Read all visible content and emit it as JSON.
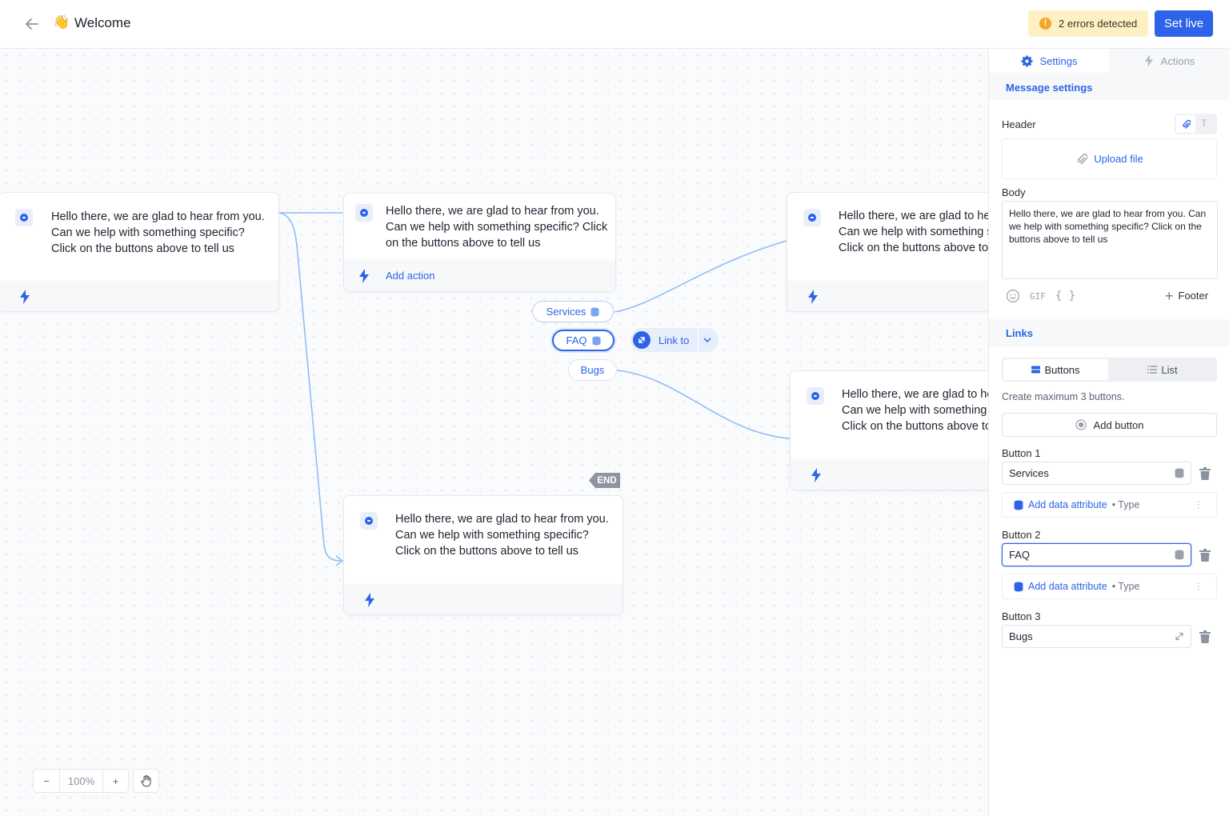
{
  "header": {
    "back_label": "←",
    "title_emoji": "👋",
    "title": "Welcome",
    "errors_label": "2 errors detected",
    "errors_icon": "!",
    "set_live_label": "Set live"
  },
  "canvas": {
    "nodes": [
      {
        "text": "Hello there, we are glad to hear from you. Can we help with something specific? Click on the buttons above to tell us"
      },
      {
        "text": "Hello there, we are glad to hear from you. Can we help with something specific? Click on the buttons above to tell us",
        "add_action": "Add action"
      },
      {
        "text": "Hello there, we are glad to hear from you. Can we help with something specific? Click on the buttons above to tell us"
      },
      {
        "text": "Hello there, we are glad to hear from you. Can we help with something specific? Click on the buttons above to tell us"
      },
      {
        "text": "Hello there, we are glad to hear from you. Can we help with something specific? Click on the buttons above to tell us"
      }
    ],
    "choice_pills": [
      "Services",
      "FAQ",
      "Bugs"
    ],
    "link_to_label": "Link to",
    "end_tag": "END",
    "zoom": {
      "minus": "−",
      "value": "100%",
      "plus": "+"
    }
  },
  "panel": {
    "tabs": {
      "settings": "Settings",
      "actions": "Actions"
    },
    "message_settings_title": "Message settings",
    "header_label": "Header",
    "header_text_toggle": "T",
    "upload_label": "Upload file",
    "body_label": "Body",
    "body_text": "Hello there, we are glad to hear from you. Can we help with something specific? Click on the buttons above to tell us",
    "gif_label": "GIF",
    "variable_label": "{ }",
    "footer_label": "Footer",
    "links_title": "Links",
    "segment": {
      "buttons": "Buttons",
      "list": "List"
    },
    "hint": "Create maximum 3 buttons.",
    "add_button_label": "Add button",
    "buttons": [
      {
        "label": "Button 1",
        "value": "Services"
      },
      {
        "label": "Button 2",
        "value": "FAQ"
      },
      {
        "label": "Button 3",
        "value": "Bugs"
      }
    ],
    "attribute": {
      "add": "Add data attribute",
      "type": "• Type"
    }
  },
  "colors": {
    "accent": "#2d63e8",
    "warning_bg": "#fdf0c4",
    "warning_dot": "#f5a623",
    "edge": "#8fbef5"
  }
}
